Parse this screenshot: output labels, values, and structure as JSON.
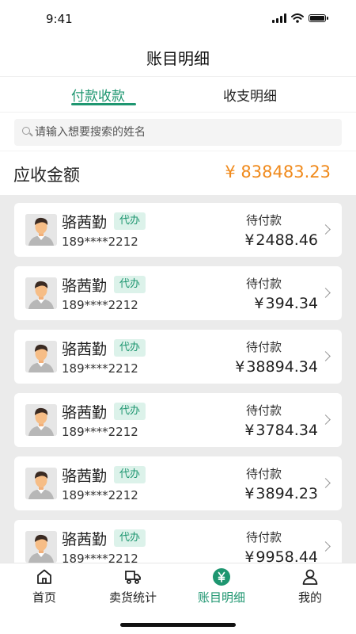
{
  "status_bar": {
    "time": "9:41"
  },
  "header": {
    "title": "账目明细"
  },
  "tabs": [
    {
      "label": "付款收款",
      "active": true
    },
    {
      "label": "收支明细",
      "active": false
    }
  ],
  "search": {
    "placeholder": "请输入想要搜索的姓名",
    "value": ""
  },
  "summary": {
    "label": "应收金额",
    "amount": "¥ 838483.23",
    "amount_color": "#f08a1c"
  },
  "records": [
    {
      "name": "骆茜勤",
      "badge": "代办",
      "phone": "189****2212",
      "status": "待付款",
      "currency": "¥",
      "amount": "2488.46"
    },
    {
      "name": "骆茜勤",
      "badge": "代办",
      "phone": "189****2212",
      "status": "待付款",
      "currency": "¥",
      "amount": "394.34"
    },
    {
      "name": "骆茜勤",
      "badge": "代办",
      "phone": "189****2212",
      "status": "待付款",
      "currency": "¥",
      "amount": "38894.34"
    },
    {
      "name": "骆茜勤",
      "badge": "代办",
      "phone": "189****2212",
      "status": "待付款",
      "currency": "¥",
      "amount": "3784.34"
    },
    {
      "name": "骆茜勤",
      "badge": "代办",
      "phone": "189****2212",
      "status": "待付款",
      "currency": "¥",
      "amount": "3894.23"
    },
    {
      "name": "骆茜勤",
      "badge": "代办",
      "phone": "189****2212",
      "status": "待付款",
      "currency": "¥",
      "amount": "9958.44"
    }
  ],
  "bottom_nav": [
    {
      "label": "首页",
      "icon": "home-icon",
      "active": false
    },
    {
      "label": "卖货统计",
      "icon": "truck-icon",
      "active": false
    },
    {
      "label": "账目明细",
      "icon": "yen-icon",
      "active": true
    },
    {
      "label": "我的",
      "icon": "user-icon",
      "active": false
    }
  ],
  "colors": {
    "accent": "#1e9670",
    "amount_highlight": "#f08a1c",
    "list_background": "#ebebeb"
  }
}
